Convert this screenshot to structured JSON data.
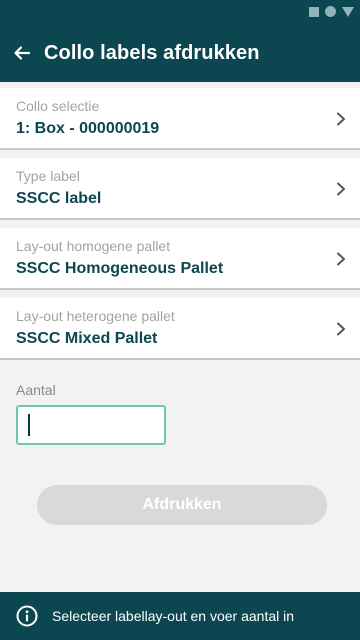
{
  "header": {
    "title": "Collo labels afdrukken",
    "back_icon": "arrow-left-icon"
  },
  "colors": {
    "primary": "#0c4650",
    "accent": "#6fc7b2",
    "disabled_button": "#d9d9d9"
  },
  "rows": [
    {
      "label": "Collo selectie",
      "value": "1: Box - 000000019"
    },
    {
      "label": "Type label",
      "value": "SSCC label"
    },
    {
      "label": "Lay-out homogene pallet",
      "value": "SSCC Homogeneous Pallet"
    },
    {
      "label": "Lay-out heterogene pallet",
      "value": "SSCC Mixed Pallet"
    }
  ],
  "quantity": {
    "label": "Aantal",
    "value": ""
  },
  "print_button": {
    "label": "Afdrukken",
    "enabled": false
  },
  "footer": {
    "icon": "info-icon",
    "message": "Selecteer labellay-out en voer aantal in"
  }
}
